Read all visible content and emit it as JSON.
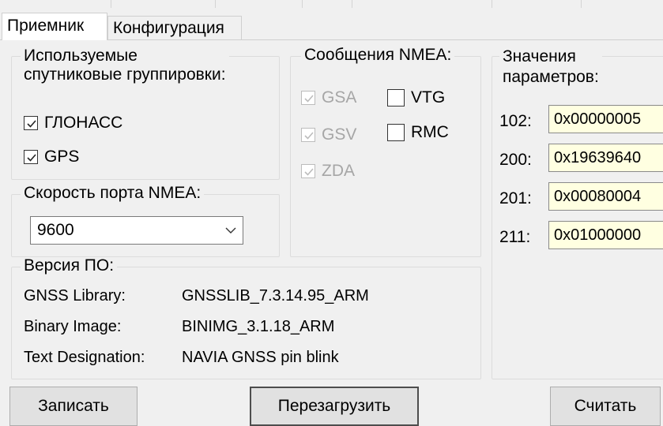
{
  "tabs": [
    {
      "label": "Приемник",
      "active": true
    },
    {
      "label": "Конфигурация",
      "active": false
    }
  ],
  "constellations": {
    "title_line1": "Используемые",
    "title_line2": "спутниковые группировки:",
    "items": [
      {
        "label": "ГЛОНАСС",
        "checked": true
      },
      {
        "label": "GPS",
        "checked": true
      }
    ]
  },
  "nmea_messages": {
    "title": "Сообщения NMEA:",
    "items": [
      {
        "label": "GSA",
        "checked": true,
        "enabled": false
      },
      {
        "label": "VTG",
        "checked": false,
        "enabled": true
      },
      {
        "label": "GSV",
        "checked": true,
        "enabled": false
      },
      {
        "label": "RMC",
        "checked": false,
        "enabled": true
      },
      {
        "label": "ZDA",
        "checked": true,
        "enabled": false
      }
    ]
  },
  "port_speed": {
    "title": "Скорость порта NMEA:",
    "value": "9600"
  },
  "parameters": {
    "title_line1": "Значения",
    "title_line2": "параметров:",
    "items": [
      {
        "id": "102:",
        "value": "0x00000005"
      },
      {
        "id": "200:",
        "value": "0x19639640"
      },
      {
        "id": "201:",
        "value": "0x00080004"
      },
      {
        "id": "211:",
        "value": "0x01000000"
      }
    ]
  },
  "firmware": {
    "title": "Версия ПО:",
    "rows": [
      {
        "key": "GNSS Library:",
        "value": "GNSSLIB_7.3.14.95_ARM"
      },
      {
        "key": "Binary Image:",
        "value": "BINIMG_3.1.18_ARM"
      },
      {
        "key": "Text Designation:",
        "value": "NAVIA GNSS pin blink"
      }
    ]
  },
  "buttons": {
    "write": "Записать",
    "reboot": "Перезагрузить",
    "read": "Считать"
  },
  "colors": {
    "hex_field_bg": "#ffffe1",
    "window_bg": "#f0f0f0",
    "disabled_text": "#a6a6a6"
  }
}
